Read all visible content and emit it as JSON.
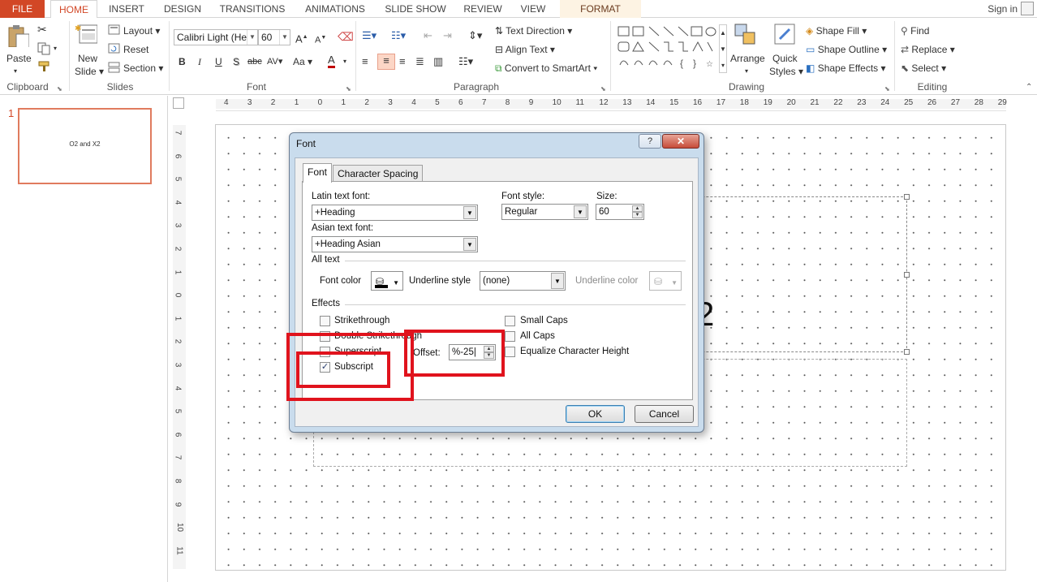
{
  "tabs": {
    "file": "FILE",
    "home": "HOME",
    "insert": "INSERT",
    "design": "DESIGN",
    "transitions": "TRANSITIONS",
    "animations": "ANIMATIONS",
    "slideshow": "SLIDE SHOW",
    "review": "REVIEW",
    "view": "VIEW",
    "format": "FORMAT",
    "signin": "Sign in"
  },
  "ribbon": {
    "clipboard": {
      "paste": "Paste",
      "label": "Clipboard"
    },
    "slides": {
      "new_slide_1": "New",
      "new_slide_2": "Slide",
      "layout": "Layout",
      "reset": "Reset",
      "section": "Section",
      "label": "Slides"
    },
    "font": {
      "family": "Calibri Light (He",
      "size": "60",
      "bold": "B",
      "italic": "I",
      "underline": "U",
      "shadow": "S",
      "strike": "abc",
      "spacing": "AV",
      "case": "Aa",
      "color": "A",
      "label": "Font"
    },
    "paragraph": {
      "text_direction": "Text Direction",
      "align_text": "Align Text",
      "smartart": "Convert to SmartArt",
      "label": "Paragraph"
    },
    "drawing": {
      "arrange": "Arrange",
      "quick_styles_1": "Quick",
      "quick_styles_2": "Styles",
      "shape_fill": "Shape Fill",
      "shape_outline": "Shape Outline",
      "shape_effects": "Shape Effects",
      "label": "Drawing"
    },
    "editing": {
      "find": "Find",
      "replace": "Replace",
      "select": "Select",
      "label": "Editing"
    }
  },
  "slide_pane": {
    "number": "1",
    "thumb_text": "O2 and X2"
  },
  "ruler": {
    "h_ticks": [
      "4",
      "3",
      "2",
      "1",
      "0",
      "1",
      "2",
      "3",
      "4",
      "5",
      "6",
      "7",
      "8",
      "9",
      "10",
      "11",
      "12",
      "13",
      "14",
      "15",
      "16",
      "17",
      "18",
      "19",
      "20",
      "21",
      "22",
      "23",
      "24",
      "25",
      "26",
      "27",
      "28",
      "29"
    ],
    "v_ticks": [
      "7",
      "6",
      "5",
      "4",
      "3",
      "2",
      "1",
      "0",
      "1",
      "2",
      "3",
      "4",
      "5",
      "6",
      "7",
      "8",
      "9",
      "10",
      "11"
    ]
  },
  "slide_peek": {
    "subscript_digit": "2"
  },
  "dialog": {
    "title": "Font",
    "help": "?",
    "close": "✕",
    "tab_font": "Font",
    "tab_spacing": "Character Spacing",
    "latin_label": "Latin text font:",
    "latin_value": "+Heading",
    "style_label": "Font style:",
    "style_value": "Regular",
    "size_label": "Size:",
    "size_value": "60",
    "asian_label": "Asian text font:",
    "asian_value": "+Heading Asian",
    "all_text": "All text",
    "font_color": "Font color",
    "underline_style": "Underline style",
    "underline_value": "(none)",
    "underline_color": "Underline color",
    "effects": "Effects",
    "strikethrough": "Strikethrough",
    "double_strikethrough": "Double Strikethrough",
    "superscript": "Superscript",
    "subscript": "Subscript",
    "offset_label": "Offset:",
    "offset_value": "%-25",
    "small_caps": "Small Caps",
    "all_caps": "All Caps",
    "equalize": "Equalize Character Height",
    "ok": "OK",
    "cancel": "Cancel",
    "subscript_checked": true
  },
  "colors": {
    "accent": "#d24726",
    "highlight_box": "#e0131d"
  }
}
